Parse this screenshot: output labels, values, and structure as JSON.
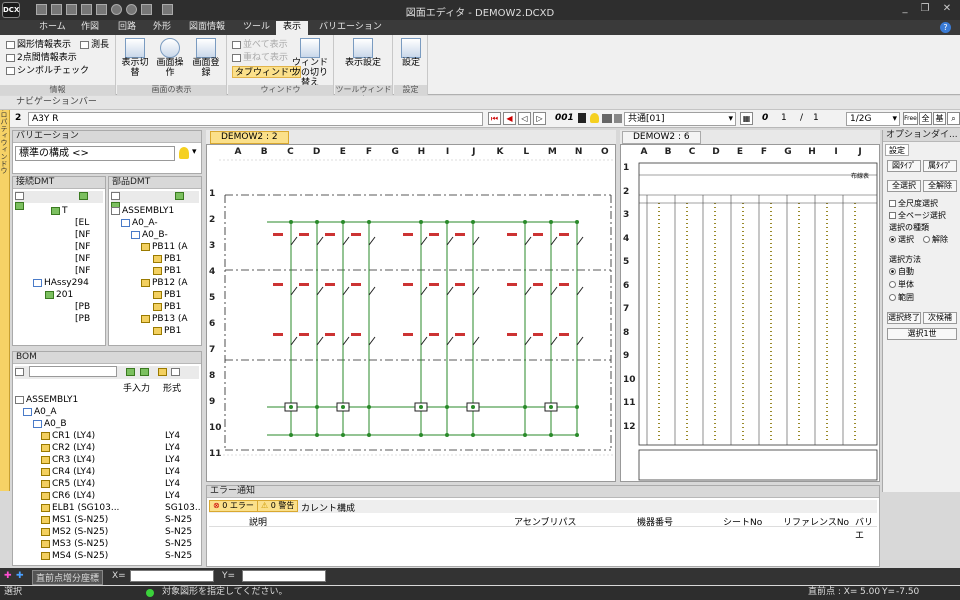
{
  "app": {
    "title": "図面エディタ - DEMOW2.DCXD",
    "logo": "DCX"
  },
  "menu": [
    "ホーム",
    "作図",
    "回路",
    "外形",
    "図面情報",
    "ツール",
    "表示",
    "バリエーション"
  ],
  "menu_active_index": 6,
  "ribbon": {
    "info": {
      "items": [
        "図形情報表示",
        "2点間情報表示",
        "シンボルチェック"
      ],
      "measure": "測長",
      "title": "情報"
    },
    "display": {
      "toggle": "表示切替",
      "operation": "画面操作",
      "register": "画面登録",
      "title": "画面の表示"
    },
    "window": {
      "tile": "並べて表示",
      "cascade": "重ねて表示",
      "tab": "タブウィンドウ",
      "switch": "ウィンドウの切り替え",
      "title": "ウィンドウ"
    },
    "toolwin": {
      "settings": "表示設定",
      "title": "ツールウィンドウ"
    },
    "config": {
      "settings": "設定",
      "title": "設定"
    }
  },
  "navbar": {
    "title": "ナビゲーションバー"
  },
  "toolbar2": {
    "sheet_no": "2",
    "sheet_name": "A3Y R",
    "page": "001",
    "layer": "共通[01]",
    "zero": "0",
    "page_cur": "1",
    "page_sep": "/",
    "page_total": "1",
    "scale": "1/2G",
    "free": "Free",
    "all": "全",
    "base": "基"
  },
  "vtab": "プロパティウィンドウ",
  "variation": {
    "title": "バリエーション",
    "value": "標準の構成 <>"
  },
  "conn_dmt": {
    "title": "接続DMT",
    "items": [
      "T",
      "[EL",
      "[NF",
      "[NF",
      "[NF",
      "[NF",
      "HAssy294",
      "201",
      "[PB",
      "[PB"
    ]
  },
  "parts_dmt": {
    "title": "部品DMT",
    "items": [
      "ASSEMBLY1",
      "A0_A-",
      "A0_B-",
      "PB11 (A",
      "PB1",
      "PB1",
      "PB12 (A",
      "PB1",
      "PB1",
      "PB13 (A",
      "PB1"
    ]
  },
  "bom": {
    "title": "BOM",
    "cols": [
      "手入力",
      "形式"
    ],
    "rows": [
      {
        "name": "ASSEMBLY1",
        "type": ""
      },
      {
        "name": "A0_A",
        "type": ""
      },
      {
        "name": "A0_B",
        "type": ""
      },
      {
        "name": "CR1 (LY4)",
        "type": "LY4"
      },
      {
        "name": "CR2 (LY4)",
        "type": "LY4"
      },
      {
        "name": "CR3 (LY4)",
        "type": "LY4"
      },
      {
        "name": "CR4 (LY4)",
        "type": "LY4"
      },
      {
        "name": "CR5 (LY4)",
        "type": "LY4"
      },
      {
        "name": "CR6 (LY4)",
        "type": "LY4"
      },
      {
        "name": "ELB1 (SG103...",
        "type": "SG103..."
      },
      {
        "name": "MS1 (S-N25)",
        "type": "S-N25"
      },
      {
        "name": "MS2 (S-N25)",
        "type": "S-N25"
      },
      {
        "name": "MS3 (S-N25)",
        "type": "S-N25"
      },
      {
        "name": "MS4 (S-N25)",
        "type": "S-N25"
      }
    ]
  },
  "drawing1": {
    "tab": "DEMOW2 : 2",
    "cols": [
      "A",
      "B",
      "C",
      "D",
      "E",
      "F",
      "G",
      "H",
      "I",
      "J",
      "K",
      "L",
      "M",
      "N",
      "O"
    ],
    "rows": [
      "1",
      "2",
      "3",
      "4",
      "5",
      "6",
      "7",
      "8",
      "9",
      "10",
      "11"
    ]
  },
  "drawing2": {
    "tab": "DEMOW2 : 6",
    "cols": [
      "A",
      "B",
      "C",
      "D",
      "E",
      "F",
      "G",
      "H",
      "I",
      "J"
    ],
    "rows": [
      "1",
      "2",
      "3",
      "4",
      "5",
      "6",
      "7",
      "8",
      "9",
      "10",
      "11",
      "12"
    ],
    "title_text": "布線表"
  },
  "options": {
    "title": "オプションダイ...",
    "tab": "設定",
    "fig_type": "図ﾀｲﾌﾟ",
    "attr_type": "属ﾀｲﾌﾟ",
    "select_all": "全選択",
    "deselect_all": "全解除",
    "all_scale": "全尺度選択",
    "all_page": "全ページ選択",
    "select_kind": "選択の種類",
    "kind_select": "選択",
    "kind_release": "解除",
    "method": "選択方法",
    "auto": "自動",
    "single": "単体",
    "range": "範囲",
    "end": "選択終了",
    "next": "次候補",
    "back": "選択1世"
  },
  "errors": {
    "title": "エラー通知",
    "error_count": "0 エラー",
    "warn_count": "0 警告",
    "current": "カレント構成",
    "cols": [
      "説明",
      "アセンブリパス",
      "機器番号",
      "シートNo",
      "リファレンスNo",
      "バリエ"
    ]
  },
  "coord": {
    "label": "直前点增分座標",
    "x_label": "X=",
    "y_label": "Y="
  },
  "status": {
    "left": "選択",
    "message": "対象図形を指定してください。",
    "point_label": "直前点 : X=",
    "x": "5.00",
    "y_label": "Y=",
    "y": "-7.50"
  }
}
